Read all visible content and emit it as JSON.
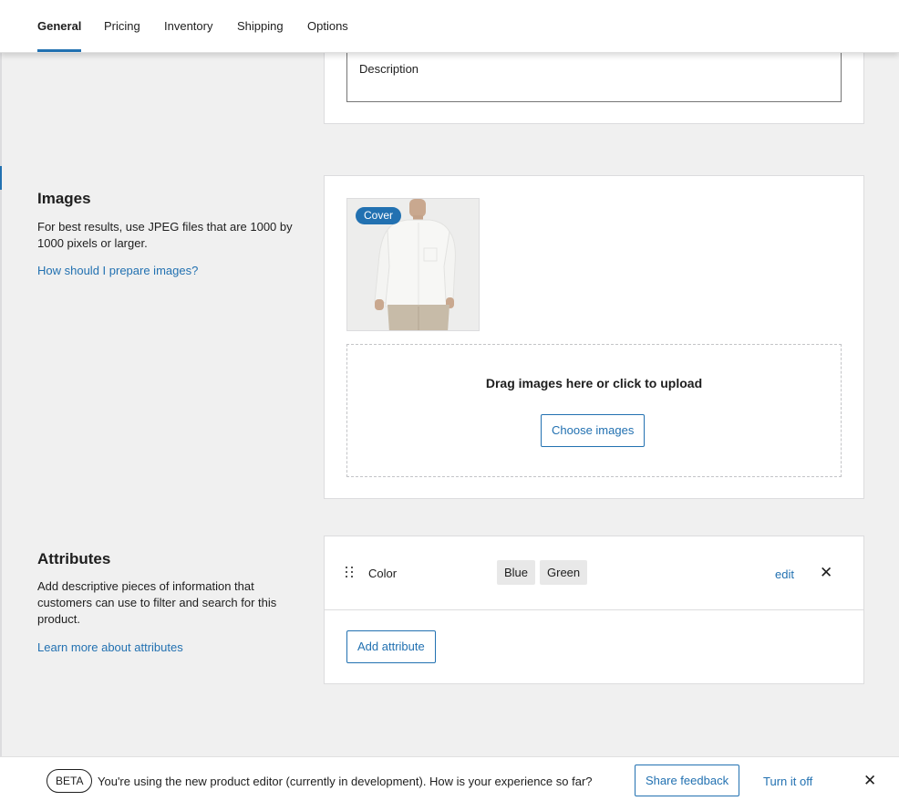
{
  "tabs": [
    {
      "label": "General",
      "active": true
    },
    {
      "label": "Pricing",
      "active": false
    },
    {
      "label": "Inventory",
      "active": false
    },
    {
      "label": "Shipping",
      "active": false
    },
    {
      "label": "Options",
      "active": false
    }
  ],
  "description": {
    "field_label": "Description"
  },
  "images": {
    "title": "Images",
    "help_text": "For best results, use JPEG files that are 1000 by 1000 pixels or larger.",
    "help_link": "How should I prepare images?",
    "cover_badge": "Cover",
    "drop_text": "Drag images here or click to upload",
    "choose_button": "Choose images"
  },
  "attributes": {
    "title": "Attributes",
    "help_text": "Add descriptive pieces of information that customers can use to filter and search for this product.",
    "help_link": "Learn more about attributes",
    "items": [
      {
        "name": "Color",
        "values": [
          "Blue",
          "Green"
        ],
        "edit_label": "edit",
        "remove_icon": "close-icon"
      }
    ],
    "add_button": "Add attribute"
  },
  "beta_bar": {
    "badge": "BETA",
    "message": "You're using the new product editor (currently in development). How is your experience so far?",
    "feedback_button": "Share feedback",
    "turn_off_link": "Turn it off",
    "close_icon": "close-icon"
  },
  "colors": {
    "accent": "#2271b1",
    "background": "#f0f0f0",
    "card": "#ffffff",
    "border": "#dcdcde",
    "chip": "#e8e8e8"
  }
}
